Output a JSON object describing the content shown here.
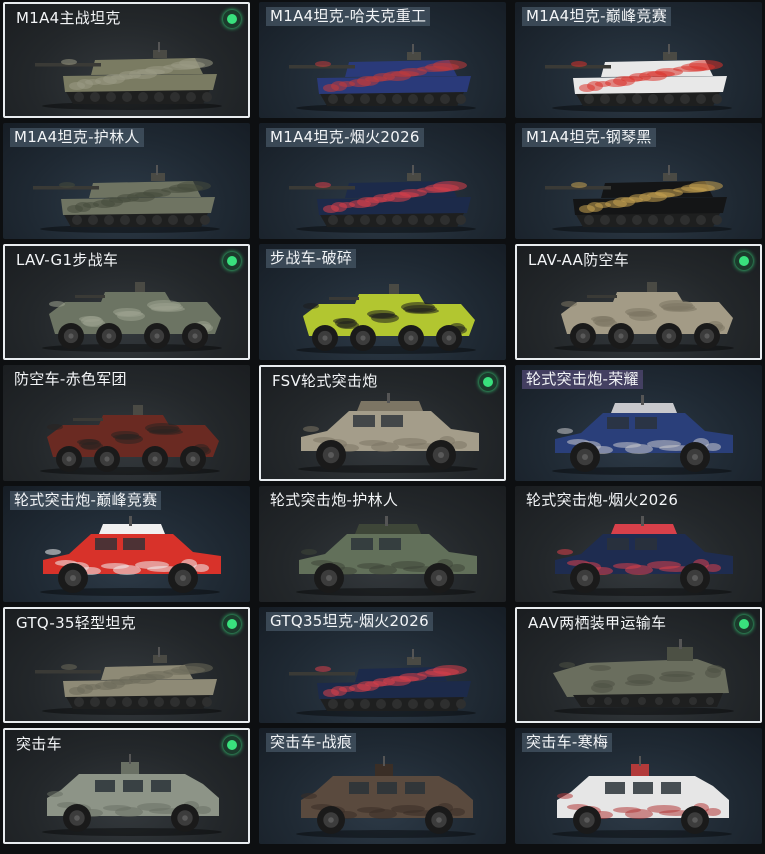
{
  "vehicles": [
    {
      "name": "M1A4主战坦克",
      "owned": true,
      "type": "tank",
      "skin": "desert-camo",
      "bodyColor": "#7a7b62",
      "accentColor": "#9a9a85",
      "labelStyle": "plain"
    },
    {
      "name": "M1A4坦克-哈夫克重工",
      "owned": false,
      "type": "tank",
      "skin": "haavk-navy",
      "bodyColor": "#2a3a7a",
      "accentColor": "#c23a3a",
      "labelStyle": "tag"
    },
    {
      "name": "M1A4坦克-巅峰竞赛",
      "owned": false,
      "type": "tank",
      "skin": "racing-red",
      "bodyColor": "#e8e8e8",
      "accentColor": "#d8322a",
      "labelStyle": "tag"
    },
    {
      "name": "M1A4坦克-护林人",
      "owned": false,
      "type": "tank",
      "skin": "forest-camo",
      "bodyColor": "#6f7462",
      "accentColor": "#454a3c",
      "labelStyle": "tag"
    },
    {
      "name": "M1A4坦克-烟火2026",
      "owned": false,
      "type": "tank",
      "skin": "fireworks-2026",
      "bodyColor": "#1c2a4a",
      "accentColor": "#d8404a",
      "labelStyle": "tag"
    },
    {
      "name": "M1A4坦克-钢琴黑",
      "owned": false,
      "type": "tank",
      "skin": "piano-black",
      "bodyColor": "#141516",
      "accentColor": "#c9a452",
      "labelStyle": "tag"
    },
    {
      "name": "LAV-G1步战车",
      "owned": true,
      "type": "ifv",
      "skin": "woodland",
      "bodyColor": "#6c7463",
      "accentColor": "#9ca38f",
      "labelStyle": "plain"
    },
    {
      "name": "步战车-破碎",
      "owned": false,
      "type": "ifv",
      "skin": "shattered",
      "bodyColor": "#b2c630",
      "accentColor": "#1e1e1e",
      "labelStyle": "tag"
    },
    {
      "name": "LAV-AA防空车",
      "owned": true,
      "type": "ifv",
      "skin": "desert",
      "bodyColor": "#a39b86",
      "accentColor": "#7c7563",
      "labelStyle": "plain"
    },
    {
      "name": "防空车-赤色军团",
      "owned": false,
      "type": "ifv",
      "skin": "red-legion",
      "bodyColor": "#6a2a22",
      "accentColor": "#2a2220",
      "labelStyle": "plain"
    },
    {
      "name": "FSV轮式突击炮",
      "owned": true,
      "type": "mrap",
      "skin": "sand",
      "bodyColor": "#a49d8a",
      "accentColor": "#7c7564",
      "labelStyle": "plain"
    },
    {
      "name": "轮式突击炮-荣耀",
      "owned": false,
      "type": "mrap",
      "skin": "glory",
      "bodyColor": "#2a3f7a",
      "accentColor": "#c8c8cc",
      "labelStyle": "tag-purple"
    },
    {
      "name": "轮式突击炮-巅峰竞赛",
      "owned": false,
      "type": "mrap",
      "skin": "racing-red",
      "bodyColor": "#d8322a",
      "accentColor": "#f0f0f0",
      "labelStyle": "tag"
    },
    {
      "name": "轮式突击炮-护林人",
      "owned": false,
      "type": "mrap",
      "skin": "forest-camo",
      "bodyColor": "#62705a",
      "accentColor": "#3e4638",
      "labelStyle": "plain"
    },
    {
      "name": "轮式突击炮-烟火2026",
      "owned": false,
      "type": "mrap",
      "skin": "fireworks-2026",
      "bodyColor": "#1e2c50",
      "accentColor": "#d8404a",
      "labelStyle": "plain"
    },
    {
      "name": "GTQ-35轻型坦克",
      "owned": true,
      "type": "light-tank",
      "skin": "desert-camo",
      "bodyColor": "#8e8a76",
      "accentColor": "#6c6a5a",
      "labelStyle": "plain"
    },
    {
      "name": "GTQ35坦克-烟火2026",
      "owned": false,
      "type": "light-tank",
      "skin": "fireworks-2026",
      "bodyColor": "#1c2a4a",
      "accentColor": "#d8404a",
      "labelStyle": "tag"
    },
    {
      "name": "AAV两栖装甲运输车",
      "owned": true,
      "type": "amphibious",
      "skin": "olive",
      "bodyColor": "#6a6e5e",
      "accentColor": "#4c5044",
      "labelStyle": "plain"
    },
    {
      "name": "突击车",
      "owned": true,
      "type": "assault",
      "skin": "grey-camo",
      "bodyColor": "#8d9487",
      "accentColor": "#6a7064",
      "labelStyle": "plain"
    },
    {
      "name": "突击车-战痕",
      "owned": false,
      "type": "assault",
      "skin": "battle-scarred",
      "bodyColor": "#5a4a3e",
      "accentColor": "#3a2e26",
      "labelStyle": "tag"
    },
    {
      "name": "突击车-寒梅",
      "owned": false,
      "type": "assault",
      "skin": "winter-plum",
      "bodyColor": "#e6e6e6",
      "accentColor": "#b23a3a",
      "labelStyle": "tag"
    }
  ],
  "ownedIndicatorColor": "#39e07d",
  "selectedBorderColor": "#e8ecef"
}
